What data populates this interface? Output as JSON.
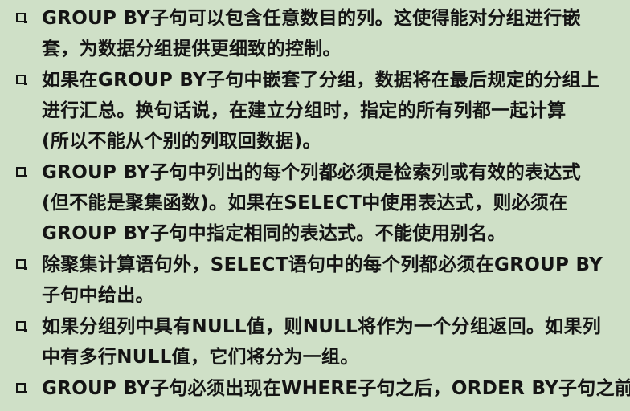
{
  "items": [
    {
      "lines": [
        "GROUP BY子句可以包含任意数目的列。这使得能对分组进行嵌",
        "套，为数据分组提供更细致的控制。"
      ]
    },
    {
      "lines": [
        "如果在GROUP BY子句中嵌套了分组，数据将在最后规定的分组上",
        "进行汇总。换句话说，在建立分组时，指定的所有列都一起计算",
        "(所以不能从个别的列取回数据)。"
      ]
    },
    {
      "lines": [
        "GROUP BY子句中列出的每个列都必须是检索列或有效的表达式",
        "(但不能是聚集函数)。如果在SELECT中使用表达式，则必须在",
        "GROUP BY子句中指定相同的表达式。不能使用别名。"
      ]
    },
    {
      "lines": [
        "除聚集计算语句外，SELECT语句中的每个列都必须在GROUP BY",
        "子句中给出。"
      ]
    },
    {
      "lines": [
        "如果分组列中具有NULL值，则NULL将作为一个分组返回。如果列",
        "中有多行NULL值，它们将分为一组。"
      ]
    },
    {
      "lines": [
        "GROUP BY子句必须出现在WHERE子句之后，ORDER BY子句之前。"
      ]
    }
  ]
}
